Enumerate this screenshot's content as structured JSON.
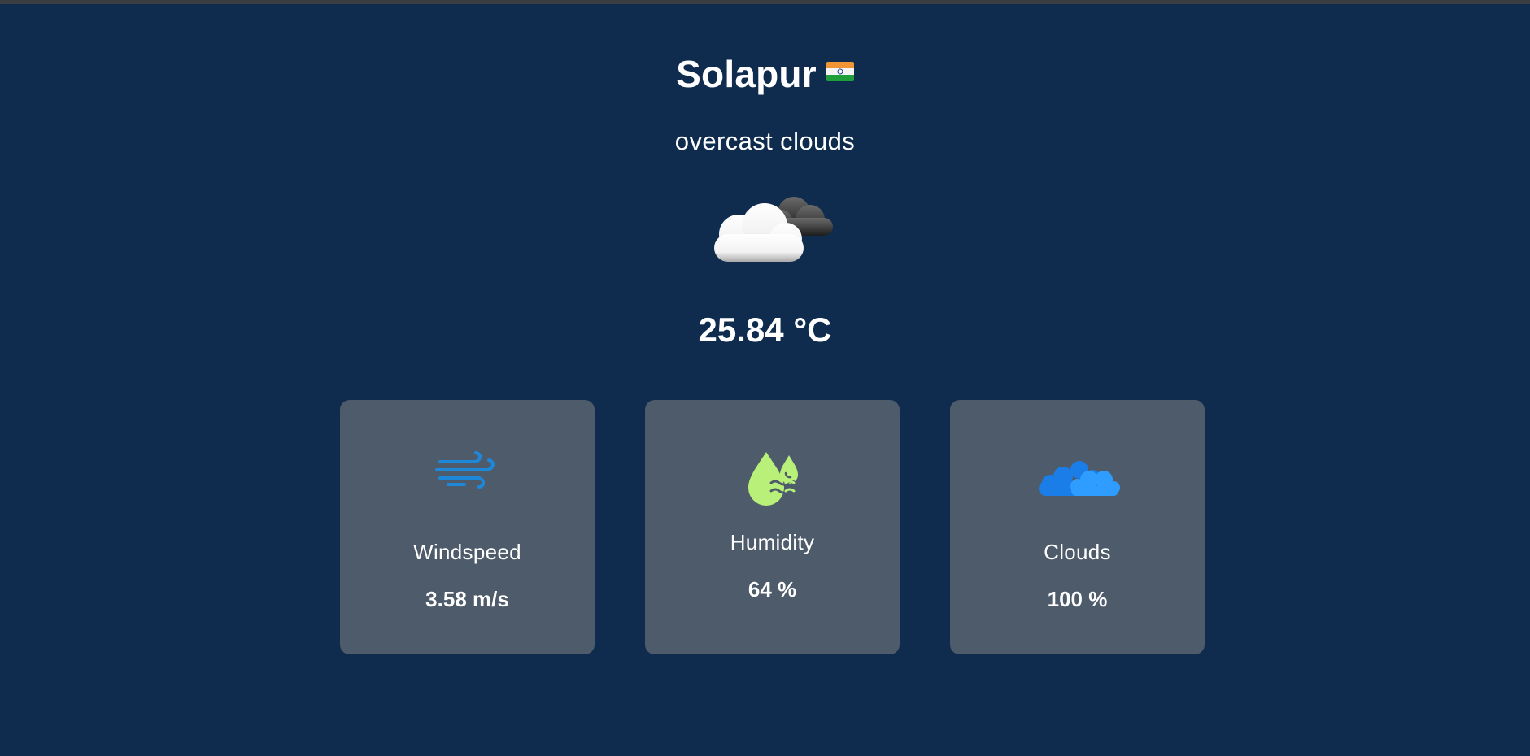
{
  "location": {
    "city": "Solapur",
    "flag_icon": "india-flag-icon"
  },
  "current": {
    "description": "overcast clouds",
    "weather_icon": "overcast-clouds-icon",
    "temperature": "25.84 °C"
  },
  "stats": {
    "windspeed": {
      "label": "Windspeed",
      "value": "3.58 m/s",
      "icon": "wind-icon"
    },
    "humidity": {
      "label": "Humidity",
      "value": "64 %",
      "icon": "humidity-drops-icon"
    },
    "clouds": {
      "label": "Clouds",
      "value": "100 %",
      "icon": "clouds-icon"
    }
  },
  "colors": {
    "background": "#0f2c4f",
    "card": "#4e5b6a",
    "text": "#ffffff",
    "wind_icon": "#1e88d8",
    "humidity_icon": "#b9f07a",
    "clouds_icon": "#1e8fff"
  }
}
